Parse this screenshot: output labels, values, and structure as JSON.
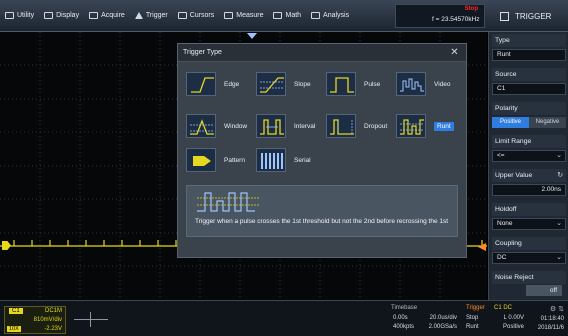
{
  "menu": {
    "items": [
      {
        "label": "Utility",
        "icon": "utility-icon"
      },
      {
        "label": "Display",
        "icon": "display-icon"
      },
      {
        "label": "Acquire",
        "icon": "acquire-icon"
      },
      {
        "label": "Trigger",
        "icon": "trigger-flag-icon"
      },
      {
        "label": "Cursors",
        "icon": "cursors-icon"
      },
      {
        "label": "Measure",
        "icon": "measure-icon"
      },
      {
        "label": "Math",
        "icon": "math-icon"
      },
      {
        "label": "Analysis",
        "icon": "analysis-icon"
      }
    ],
    "run_state": "Stop",
    "frequency": "f = 23.54570kHz",
    "panel_title": "TRIGGER"
  },
  "dialog": {
    "title": "Trigger Type",
    "types": [
      {
        "label": "Edge"
      },
      {
        "label": "Slope"
      },
      {
        "label": "Pulse"
      },
      {
        "label": "Video"
      },
      {
        "label": "Window"
      },
      {
        "label": "Interval"
      },
      {
        "label": "Dropout"
      },
      {
        "label": "Runt"
      },
      {
        "label": "Pattern"
      },
      {
        "label": "Serial"
      }
    ],
    "selected": "Runt",
    "description": "Trigger when a pulse crosses the 1st threshold but not the 2nd before recrossing the 1st"
  },
  "panel": {
    "type_label": "Type",
    "type_value": "Runt",
    "source_label": "Source",
    "source_value": "C1",
    "polarity_label": "Polarity",
    "polarity_pos": "Positive",
    "polarity_neg": "Negative",
    "limit_label": "Limit Range",
    "limit_value": "<=",
    "upper_label": "Upper Value",
    "upper_value": "2.00ns",
    "holdoff_label": "Holdoff",
    "holdoff_value": "None",
    "coupling_label": "Coupling",
    "coupling_value": "DC",
    "noise_label": "Noise Reject",
    "noise_value": "off"
  },
  "status": {
    "ch1_name": "C1",
    "ch1_coupling": "DC1M",
    "ch1_scale": "810mV/div",
    "ch1_probe": "10X",
    "ch1_offset": "-2.23V",
    "timebase_label": "Timebase",
    "tb_delay": "0.00s",
    "tb_scale": "20.0us/div",
    "tb_points": "400kpts",
    "tb_rate": "2.00GSa/s",
    "trigger_label": "Trigger",
    "trigger_source": "C1 DC",
    "trigger_mode": "Stop",
    "trigger_level": "L 0.00V",
    "trigger_type": "Runt",
    "trigger_polarity": "Positive",
    "time": "01:18:40",
    "date": "2018/11/6"
  },
  "colors": {
    "ch1": "#e6d81e",
    "accent": "#2f7de0",
    "stop": "#ff2a2a",
    "trigger": "#ff8a2a"
  }
}
